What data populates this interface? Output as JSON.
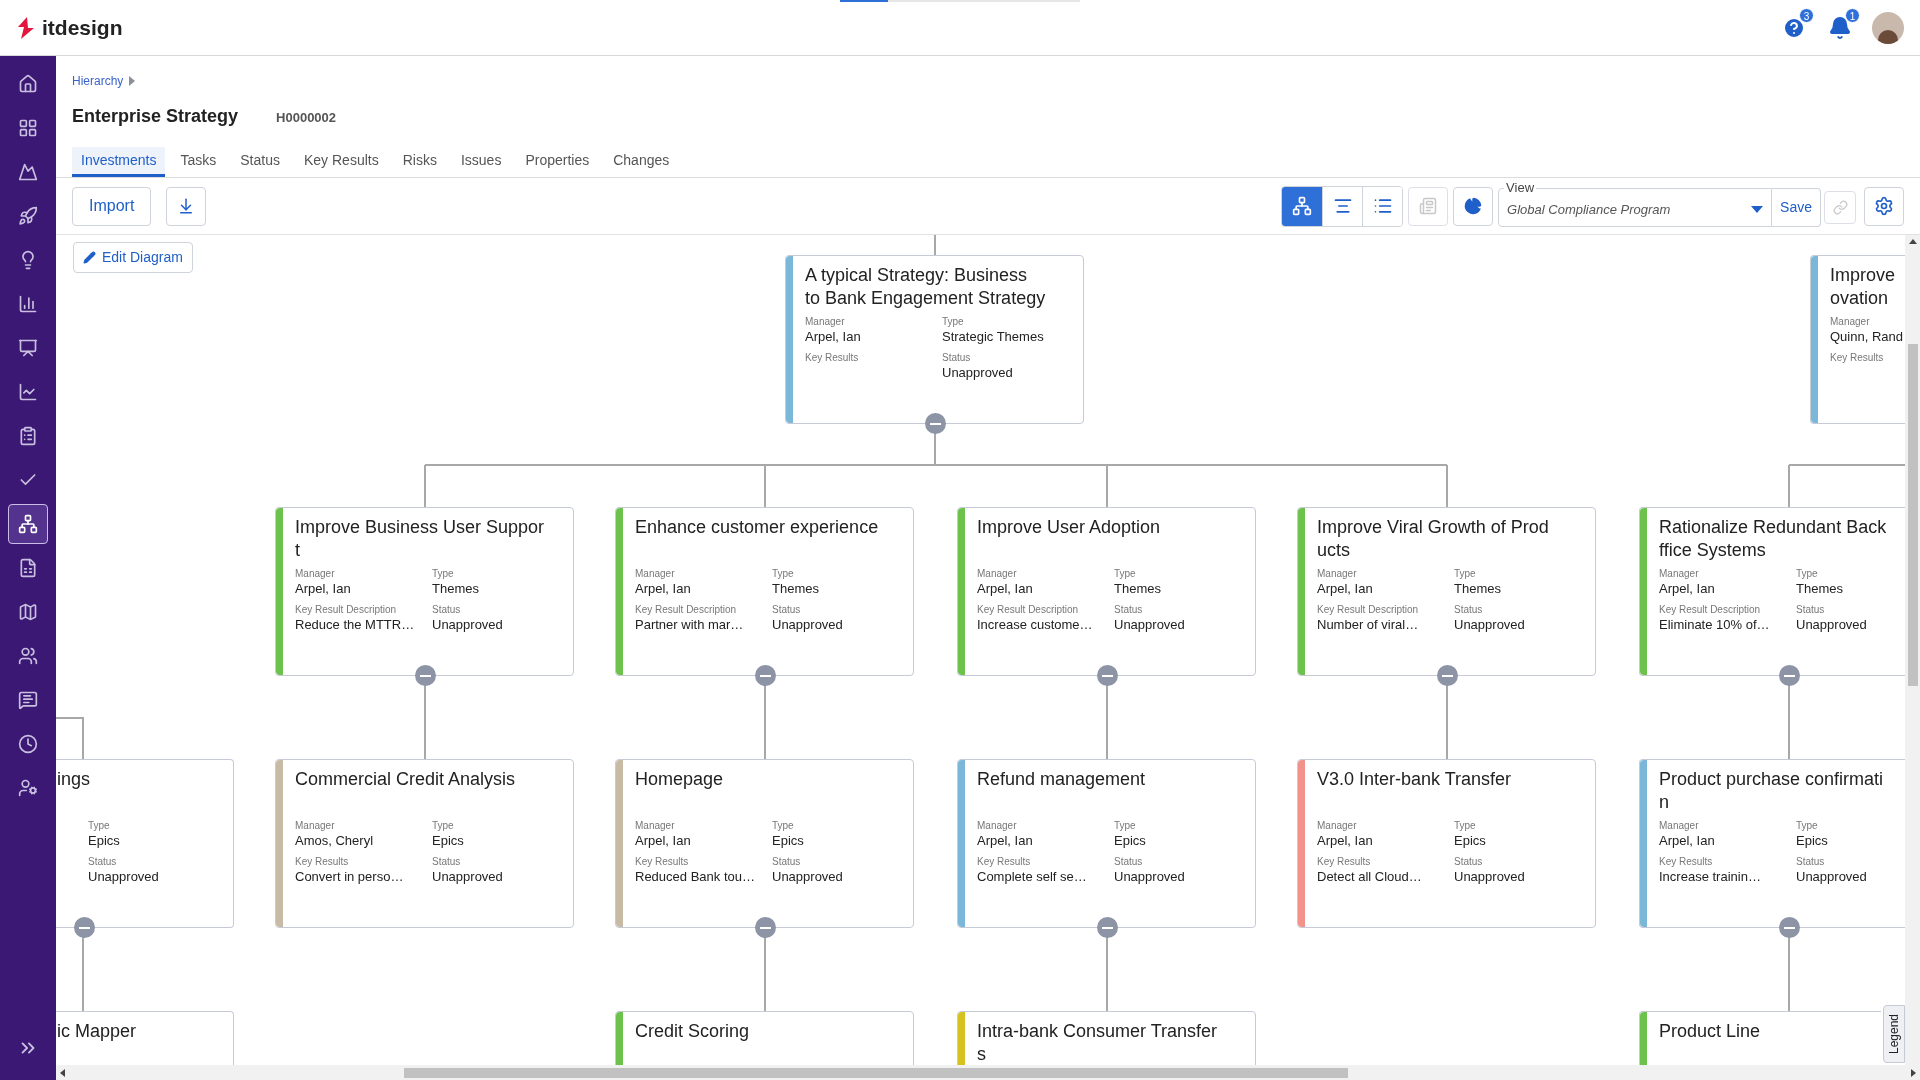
{
  "app": {
    "logo": "itdesign"
  },
  "header_icons": [
    {
      "badge": "3"
    },
    {
      "badge": "1"
    }
  ],
  "sidebar": {
    "items": [
      {
        "selected": false
      },
      {
        "selected": false
      },
      {
        "selected": false
      },
      {
        "selected": false
      },
      {
        "selected": false
      },
      {
        "selected": false
      },
      {
        "selected": false
      },
      {
        "selected": false
      },
      {
        "selected": false
      },
      {
        "selected": false
      },
      {
        "selected": true
      },
      {
        "selected": false
      },
      {
        "selected": false
      },
      {
        "selected": false
      },
      {
        "selected": false
      },
      {
        "selected": false
      },
      {
        "selected": false
      }
    ]
  },
  "breadcrumb": [
    "Hierarchy"
  ],
  "title": "Enterprise Strategy",
  "record_id": "H0000002",
  "tabs": [
    {
      "label": "Investments",
      "selected": true
    },
    {
      "label": "Tasks",
      "selected": false
    },
    {
      "label": "Status",
      "selected": false
    },
    {
      "label": "Key Results",
      "selected": false
    },
    {
      "label": "Risks",
      "selected": false
    },
    {
      "label": "Issues",
      "selected": false
    },
    {
      "label": "Properties",
      "selected": false
    },
    {
      "label": "Changes",
      "selected": false
    }
  ],
  "toolbar": {
    "import": "Import",
    "view_modes": [
      {
        "selected": true
      },
      {
        "selected": false
      },
      {
        "selected": false
      }
    ],
    "report_button": {
      "disabled": true
    },
    "view_field": {
      "label": "View",
      "value": "Global Compliance Program"
    },
    "save": "Save",
    "link_button": {
      "disabled": true
    }
  },
  "edit_diagram": "Edit Diagram",
  "diagram": {
    "rows": [
      {
        "cards": [
          {
            "kind": "full",
            "color": "#7ab7d8",
            "title_lines": [
              "A typical Strategy: Business",
              "to Bank Engagement Strategy"
            ],
            "fields": [
              {
                "label": "Manager",
                "value": "Arpel, Ian"
              },
              {
                "label": "Type",
                "value": "Strategic Themes"
              },
              {
                "label": "Key Results"
              },
              {
                "label": "Status",
                "value": "Unapproved"
              }
            ],
            "collapsible": true
          },
          {
            "kind": "clipped_right",
            "color": "#7ab7d8",
            "title_lines": [
              "Improve",
              "ovation"
            ],
            "fields": [
              {
                "label": "Manager",
                "value": "Quinn, Rand"
              },
              {
                "label": "Key Results"
              }
            ],
            "collapsible": false
          }
        ]
      },
      {
        "cards": [
          {
            "kind": "full",
            "color": "#6cc24a",
            "title_lines": [
              "Improve Business User Suppor",
              "t"
            ],
            "fields": [
              {
                "label": "Manager",
                "value": "Arpel, Ian"
              },
              {
                "label": "Type",
                "value": "Themes"
              },
              {
                "label": "Key Result Description",
                "value": "Reduce the MTTR…"
              },
              {
                "label": "Status",
                "value": "Unapproved"
              }
            ],
            "collapsible": true
          },
          {
            "kind": "full",
            "color": "#6cc24a",
            "title_lines": [
              "Enhance customer experience"
            ],
            "fields": [
              {
                "label": "Manager",
                "value": "Arpel, Ian"
              },
              {
                "label": "Type",
                "value": "Themes"
              },
              {
                "label": "Key Result Description",
                "value": "Partner with mar…"
              },
              {
                "label": "Status",
                "value": "Unapproved"
              }
            ],
            "collapsible": true
          },
          {
            "kind": "full",
            "color": "#6cc24a",
            "title_lines": [
              "Improve User Adoption"
            ],
            "fields": [
              {
                "label": "Manager",
                "value": "Arpel, Ian"
              },
              {
                "label": "Type",
                "value": "Themes"
              },
              {
                "label": "Key Result Description",
                "value": "Increase custome…"
              },
              {
                "label": "Status",
                "value": "Unapproved"
              }
            ],
            "collapsible": true
          },
          {
            "kind": "full",
            "color": "#6cc24a",
            "title_lines": [
              "Improve Viral Growth of Prod",
              "ucts"
            ],
            "fields": [
              {
                "label": "Manager",
                "value": "Arpel, Ian"
              },
              {
                "label": "Type",
                "value": "Themes"
              },
              {
                "label": "Key Result Description",
                "value": "Number of viral…"
              },
              {
                "label": "Status",
                "value": "Unapproved"
              }
            ],
            "collapsible": true
          },
          {
            "kind": "clipped_right",
            "color": "#6cc24a",
            "title_lines": [
              "Rationalize Redundant Back",
              "ffice Systems"
            ],
            "fields": [
              {
                "label": "Manager",
                "value": "Arpel, Ian"
              },
              {
                "label": "Type",
                "value": "Themes"
              },
              {
                "label": "Key Result Description",
                "value": "Eliminate 10% of…"
              },
              {
                "label": "Status",
                "value": "Unapproved"
              }
            ],
            "collapsible": true
          }
        ]
      },
      {
        "cards": [
          {
            "kind": "clipped_left",
            "title_lines": [
              "ings"
            ],
            "fields": [
              {
                "label": "Type",
                "value": "Epics"
              },
              {
                "label": "Status",
                "value": "Unapproved"
              }
            ],
            "collapsible": true
          },
          {
            "kind": "full",
            "color": "#c8bba6",
            "title_lines": [
              "Commercial Credit Analysis"
            ],
            "fields": [
              {
                "label": "Manager",
                "value": "Amos, Cheryl"
              },
              {
                "label": "Type",
                "value": "Epics"
              },
              {
                "label": "Key Results",
                "value": "Convert in perso…"
              },
              {
                "label": "Status",
                "value": "Unapproved"
              }
            ],
            "collapsible": false
          },
          {
            "kind": "full",
            "color": "#c8bba6",
            "title_lines": [
              "Homepage"
            ],
            "fields": [
              {
                "label": "Manager",
                "value": "Arpel, Ian"
              },
              {
                "label": "Type",
                "value": "Epics"
              },
              {
                "label": "Key Results",
                "value": "Reduced Bank tou…"
              },
              {
                "label": "Status",
                "value": "Unapproved"
              }
            ],
            "collapsible": true
          },
          {
            "kind": "full",
            "color": "#7ab7d8",
            "title_lines": [
              "Refund management"
            ],
            "fields": [
              {
                "label": "Manager",
                "value": "Arpel, Ian"
              },
              {
                "label": "Type",
                "value": "Epics"
              },
              {
                "label": "Key Results",
                "value": "Complete self se…"
              },
              {
                "label": "Status",
                "value": "Unapproved"
              }
            ],
            "collapsible": true
          },
          {
            "kind": "full",
            "color": "#f2928b",
            "title_lines": [
              "V3.0 Inter-bank Transfer"
            ],
            "fields": [
              {
                "label": "Manager",
                "value": "Arpel, Ian"
              },
              {
                "label": "Type",
                "value": "Epics"
              },
              {
                "label": "Key Results",
                "value": "Detect all Cloud…"
              },
              {
                "label": "Status",
                "value": "Unapproved"
              }
            ],
            "collapsible": false
          },
          {
            "kind": "clipped_right",
            "color": "#7ab7d8",
            "title_lines": [
              "Product purchase confirmati",
              "n"
            ],
            "fields": [
              {
                "label": "Manager",
                "value": "Arpel, Ian"
              },
              {
                "label": "Type",
                "value": "Epics"
              },
              {
                "label": "Key Results",
                "value": "Increase trainin…"
              },
              {
                "label": "Status",
                "value": "Unapproved"
              }
            ],
            "collapsible": true
          }
        ]
      },
      {
        "cards": [
          {
            "kind": "clipped_left",
            "title_lines": [
              "ic Mapper"
            ],
            "collapsible": false
          },
          {
            "kind": "full",
            "color": "#6cc24a",
            "title_lines": [
              "Credit Scoring"
            ],
            "collapsible": false
          },
          {
            "kind": "full",
            "color": "#d6c21c",
            "title_lines": [
              "Intra-bank Consumer Transfer",
              "s"
            ],
            "collapsible": false
          },
          {
            "kind": "clipped_right",
            "color": "#6cc24a",
            "title_lines": [
              "Product Line"
            ],
            "collapsible": false
          }
        ]
      }
    ]
  },
  "legend": "Legend"
}
